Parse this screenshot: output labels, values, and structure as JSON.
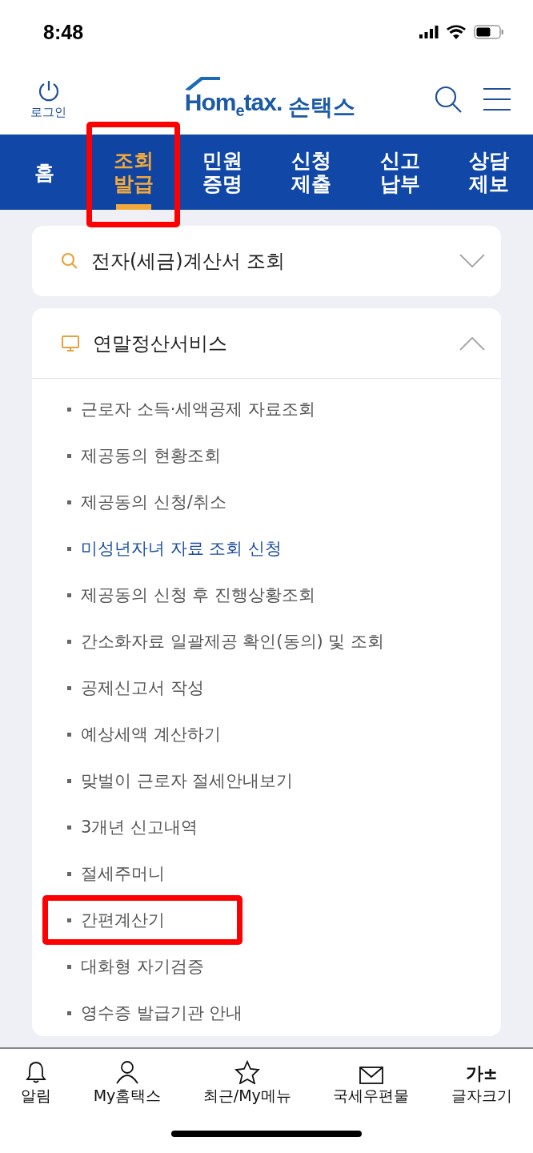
{
  "status_bar": {
    "time": "8:48"
  },
  "header": {
    "login_label": "로그인",
    "logo_brand": "Hom$_{e}$tax.",
    "logo_app": "손택스"
  },
  "nav_tabs": [
    {
      "label": "홈",
      "selected": false,
      "highlighted": false
    },
    {
      "label": "조회\n발급",
      "selected": true,
      "highlighted": true
    },
    {
      "label": "민원\n증명",
      "selected": false,
      "highlighted": false
    },
    {
      "label": "신청\n제출",
      "selected": false,
      "highlighted": false
    },
    {
      "label": "신고\n납부",
      "selected": false,
      "highlighted": false
    },
    {
      "label": "상담\n제보",
      "selected": false,
      "highlighted": false
    }
  ],
  "sections": [
    {
      "title": "전자(세금)계산서 조회",
      "expanded": false
    },
    {
      "title": "연말정산서비스",
      "expanded": true,
      "items": [
        {
          "label": "근로자 소득·세액공제 자료조회",
          "selected": false,
          "highlighted": false
        },
        {
          "label": "제공동의 현황조회",
          "selected": false,
          "highlighted": false
        },
        {
          "label": "제공동의 신청/취소",
          "selected": false,
          "highlighted": false
        },
        {
          "label": "미성년자녀 자료 조회 신청",
          "selected": true,
          "highlighted": false
        },
        {
          "label": "제공동의 신청 후 진행상황조회",
          "selected": false,
          "highlighted": false
        },
        {
          "label": "간소화자료 일괄제공 확인(동의) 및 조회",
          "selected": false,
          "highlighted": false
        },
        {
          "label": "공제신고서 작성",
          "selected": false,
          "highlighted": false
        },
        {
          "label": "예상세액 계산하기",
          "selected": false,
          "highlighted": false
        },
        {
          "label": "맞벌이 근로자 절세안내보기",
          "selected": false,
          "highlighted": false
        },
        {
          "label": "3개년 신고내역",
          "selected": false,
          "highlighted": false
        },
        {
          "label": "절세주머니",
          "selected": false,
          "highlighted": false
        },
        {
          "label": "간편계산기",
          "selected": false,
          "highlighted": true
        },
        {
          "label": "대화형 자기검증",
          "selected": false,
          "highlighted": false
        },
        {
          "label": "영수증 발급기관 안내",
          "selected": false,
          "highlighted": false
        }
      ]
    }
  ],
  "bottom_nav": [
    {
      "label": "알림"
    },
    {
      "label": "My홈택스"
    },
    {
      "label": "최근/My메뉴"
    },
    {
      "label": "국세우편물"
    },
    {
      "label": "글자크기",
      "glyph": "가±"
    }
  ]
}
